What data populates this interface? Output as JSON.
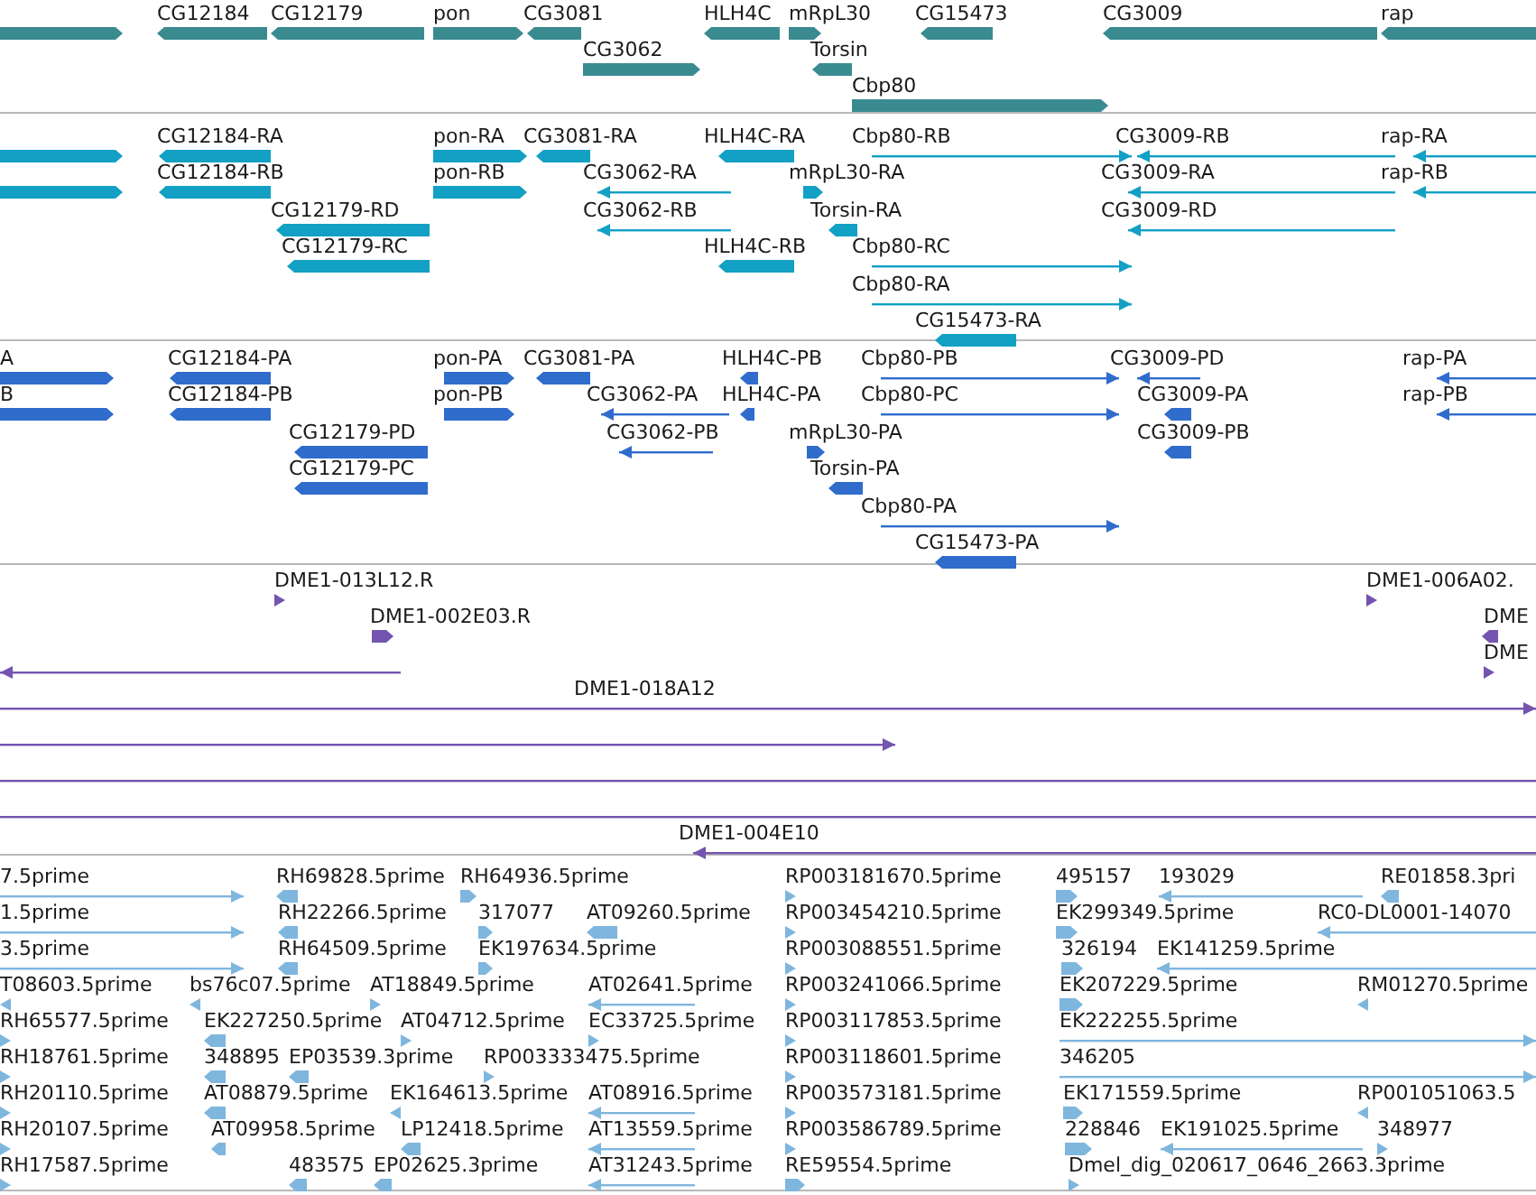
{
  "tracks": [
    {
      "color": "#3a8b90",
      "features": [
        {
          "reverse": false
        },
        {
          "label": "CG12184",
          "reverse": true
        },
        {
          "label": "CG12179",
          "reverse": true
        },
        {
          "label": "pon",
          "reverse": false
        },
        {
          "label": "CG3081",
          "reverse": true
        },
        {
          "label": "HLH4C",
          "reverse": true
        },
        {
          "label": "mRpL30",
          "reverse": false
        },
        {
          "label": "CG15473",
          "reverse": true
        },
        {
          "label": "CG3009",
          "reverse": true
        },
        {
          "label": "rap",
          "reverse": true
        },
        {
          "label": "CG3062",
          "reverse": false
        },
        {
          "label": "Torsin",
          "reverse": true
        },
        {
          "label": "Cbp80",
          "reverse": false
        }
      ]
    },
    {
      "color": "#12a0c4",
      "features": [
        {
          "reverse": false
        },
        {
          "label": "CG12184-RA",
          "reverse": true
        },
        {
          "label": "pon-RA",
          "reverse": false
        },
        {
          "label": "CG3081-RA",
          "reverse": true
        },
        {
          "label": "HLH4C-RA",
          "reverse": true
        },
        {
          "label": "Cbp80-RB",
          "reverse": false
        },
        {
          "label": "CG3009-RB",
          "reverse": true
        },
        {
          "label": "rap-RA",
          "reverse": true
        },
        {
          "reverse": false
        },
        {
          "label": "CG12184-RB",
          "reverse": true
        },
        {
          "label": "pon-RB",
          "reverse": false
        },
        {
          "label": "CG3062-RA",
          "reverse": true
        },
        {
          "label": "mRpL30-RA",
          "reverse": false
        },
        {
          "label": "CG3009-RA",
          "reverse": true
        },
        {
          "label": "rap-RB",
          "reverse": true
        },
        {
          "label": "CG12179-RD",
          "reverse": true
        },
        {
          "label": "CG3062-RB",
          "reverse": true
        },
        {
          "label": "Torsin-RA",
          "reverse": true
        },
        {
          "label": "CG3009-RD",
          "reverse": true
        },
        {
          "label": "CG12179-RC",
          "reverse": true
        },
        {
          "label": "HLH4C-RB",
          "reverse": true
        },
        {
          "label": "Cbp80-RC",
          "reverse": false
        },
        {
          "label": "Cbp80-RA",
          "reverse": false
        },
        {
          "label": "CG15473-RA",
          "reverse": true
        }
      ]
    },
    {
      "color": "#2f6ccc",
      "features": [
        {
          "label": "A",
          "reverse": false
        },
        {
          "label": "CG12184-PA",
          "reverse": true
        },
        {
          "label": "pon-PA",
          "reverse": false
        },
        {
          "label": "CG3081-PA",
          "reverse": true
        },
        {
          "label": "HLH4C-PB",
          "reverse": true
        },
        {
          "label": "Cbp80-PB",
          "reverse": false
        },
        {
          "label": "CG3009-PD",
          "reverse": true
        },
        {
          "label": "rap-PA",
          "reverse": true
        },
        {
          "label": "B",
          "reverse": false
        },
        {
          "label": "CG12184-PB",
          "reverse": true
        },
        {
          "label": "pon-PB",
          "reverse": false
        },
        {
          "label": "CG3062-PA",
          "reverse": true
        },
        {
          "label": "HLH4C-PA",
          "reverse": true
        },
        {
          "label": "Cbp80-PC",
          "reverse": false
        },
        {
          "label": "CG3009-PA",
          "reverse": true
        },
        {
          "label": "rap-PB",
          "reverse": true
        },
        {
          "label": "CG12179-PD",
          "reverse": true
        },
        {
          "label": "CG3062-PB",
          "reverse": true
        },
        {
          "label": "mRpL30-PA",
          "reverse": false
        },
        {
          "label": "CG3009-PB",
          "reverse": true
        },
        {
          "label": "CG12179-PC",
          "reverse": true
        },
        {
          "label": "Torsin-PA",
          "reverse": true
        },
        {
          "label": "Cbp80-PA",
          "reverse": false
        },
        {
          "label": "CG15473-PA",
          "reverse": true
        }
      ]
    },
    {
      "color": "#7454b0",
      "features": [
        {
          "label": "DME1-013L12.R",
          "reverse": false
        },
        {
          "label": "DME1-006A02.",
          "reverse": false
        },
        {
          "label": "DME1-002E03.R",
          "reverse": false
        },
        {
          "label": "DME",
          "reverse": true
        },
        {
          "reverse": true
        },
        {
          "label": "DME",
          "reverse": false
        },
        {
          "label": "DME1-018A12",
          "reverse": false
        },
        {
          "reverse": false
        },
        {
          "reverse": false
        },
        {
          "reverse": false
        },
        {
          "label": "DME1-004E10",
          "reverse": true
        }
      ]
    },
    {
      "color": "#7fb6de",
      "features": [
        {
          "label": "7.5prime",
          "reverse": false
        },
        {
          "label": "RH69828.5prime",
          "reverse": true
        },
        {
          "label": "RH64936.5prime",
          "reverse": false
        },
        {
          "label": "RP003181670.5prime",
          "reverse": false
        },
        {
          "label": "495157",
          "reverse": false
        },
        {
          "label": "193029",
          "reverse": true
        },
        {
          "label": "RE01858.3pri",
          "reverse": true
        },
        {
          "label": "1.5prime",
          "reverse": false
        },
        {
          "label": "RH22266.5prime",
          "reverse": true
        },
        {
          "label": "317077",
          "reverse": false
        },
        {
          "label": "AT09260.5prime",
          "reverse": true
        },
        {
          "label": "RP003454210.5prime",
          "reverse": false
        },
        {
          "label": "EK299349.5prime",
          "reverse": false
        },
        {
          "label": "RC0-DL0001-14070",
          "reverse": true
        },
        {
          "label": "3.5prime",
          "reverse": false
        },
        {
          "label": "RH64509.5prime",
          "reverse": true
        },
        {
          "label": "EK197634.5prime",
          "reverse": false
        },
        {
          "label": "RP003088551.5prime",
          "reverse": false
        },
        {
          "label": "326194",
          "reverse": false
        },
        {
          "label": "EK141259.5prime",
          "reverse": true
        },
        {
          "label": "T08603.5prime",
          "reverse": true
        },
        {
          "label": "bs76c07.5prime",
          "reverse": true
        },
        {
          "label": "AT18849.5prime",
          "reverse": false
        },
        {
          "label": "AT02641.5prime",
          "reverse": true
        },
        {
          "label": "RP003241066.5prime",
          "reverse": false
        },
        {
          "label": "EK207229.5prime",
          "reverse": false
        },
        {
          "label": "RM01270.5prime",
          "reverse": true
        },
        {
          "label": "RH65577.5prime",
          "reverse": false
        },
        {
          "label": "EK227250.5prime",
          "reverse": true
        },
        {
          "label": "AT04712.5prime",
          "reverse": false
        },
        {
          "label": "EC33725.5prime",
          "reverse": false
        },
        {
          "label": "RP003117853.5prime",
          "reverse": false
        },
        {
          "label": "EK222255.5prime",
          "reverse": false
        },
        {
          "label": "RH18761.5prime",
          "reverse": false
        },
        {
          "label": "348895",
          "reverse": true
        },
        {
          "label": "EP03539.3prime",
          "reverse": true
        },
        {
          "label": "RP003333475.5prime",
          "reverse": false
        },
        {
          "label": "RP003118601.5prime",
          "reverse": false
        },
        {
          "label": "346205",
          "reverse": false
        },
        {
          "label": "RH20110.5prime",
          "reverse": false
        },
        {
          "label": "AT08879.5prime",
          "reverse": true
        },
        {
          "label": "EK164613.5prime",
          "reverse": true
        },
        {
          "label": "AT08916.5prime",
          "reverse": true
        },
        {
          "label": "RP003573181.5prime",
          "reverse": false
        },
        {
          "label": "EK171559.5prime",
          "reverse": false
        },
        {
          "label": "RP001051063.5",
          "reverse": true
        },
        {
          "label": "RH20107.5prime",
          "reverse": false
        },
        {
          "label": "AT09958.5prime",
          "reverse": true
        },
        {
          "label": "LP12418.5prime",
          "reverse": true
        },
        {
          "label": "AT13559.5prime",
          "reverse": true
        },
        {
          "label": "RP003586789.5prime",
          "reverse": false
        },
        {
          "label": "228846",
          "reverse": false
        },
        {
          "label": "EK191025.5prime",
          "reverse": true
        },
        {
          "label": "348977",
          "reverse": false
        },
        {
          "label": "RH17587.5prime",
          "reverse": false
        },
        {
          "label": "483575",
          "reverse": true
        },
        {
          "label": "EP02625.3prime",
          "reverse": true
        },
        {
          "label": "AT31243.5prime",
          "reverse": true
        },
        {
          "label": "RE59554.5prime",
          "reverse": false
        },
        {
          "label": "Dmel_dig_020617_0646_2663.3prime",
          "reverse": false
        }
      ]
    }
  ]
}
